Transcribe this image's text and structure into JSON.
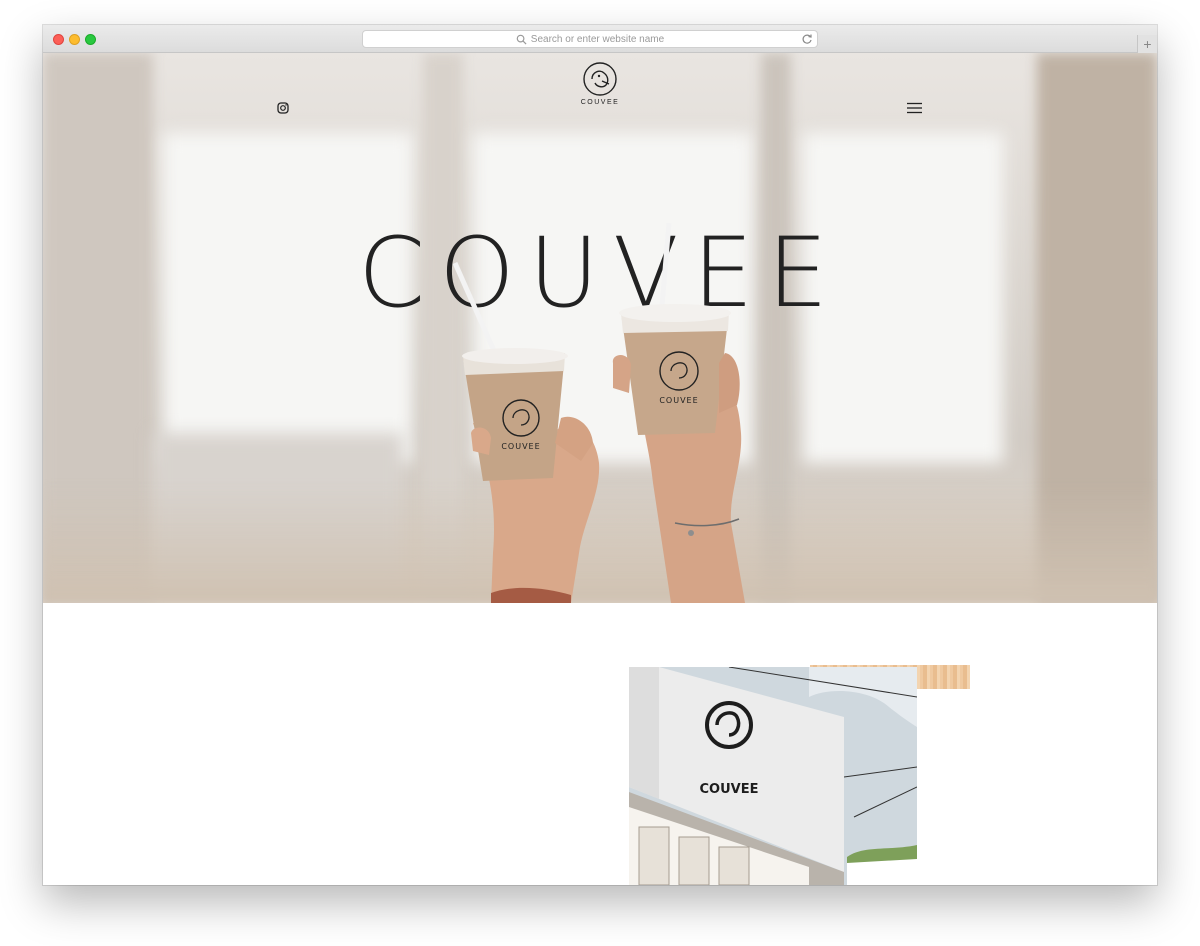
{
  "browser": {
    "address_placeholder": "Search or enter website name",
    "new_tab_symbol": "+"
  },
  "header": {
    "logo_text": "COUVEE",
    "instagram_icon": "instagram-icon",
    "menu_icon": "hamburger-menu-icon"
  },
  "hero": {
    "brand_title": "COUVEE",
    "cup_logo_text": "COUVEE"
  },
  "content": {
    "store_sign_text": "COUVEE"
  },
  "colors": {
    "brand_dark": "#222222",
    "cup_latte": "#c9a98a",
    "wood": "#efc9a0"
  }
}
